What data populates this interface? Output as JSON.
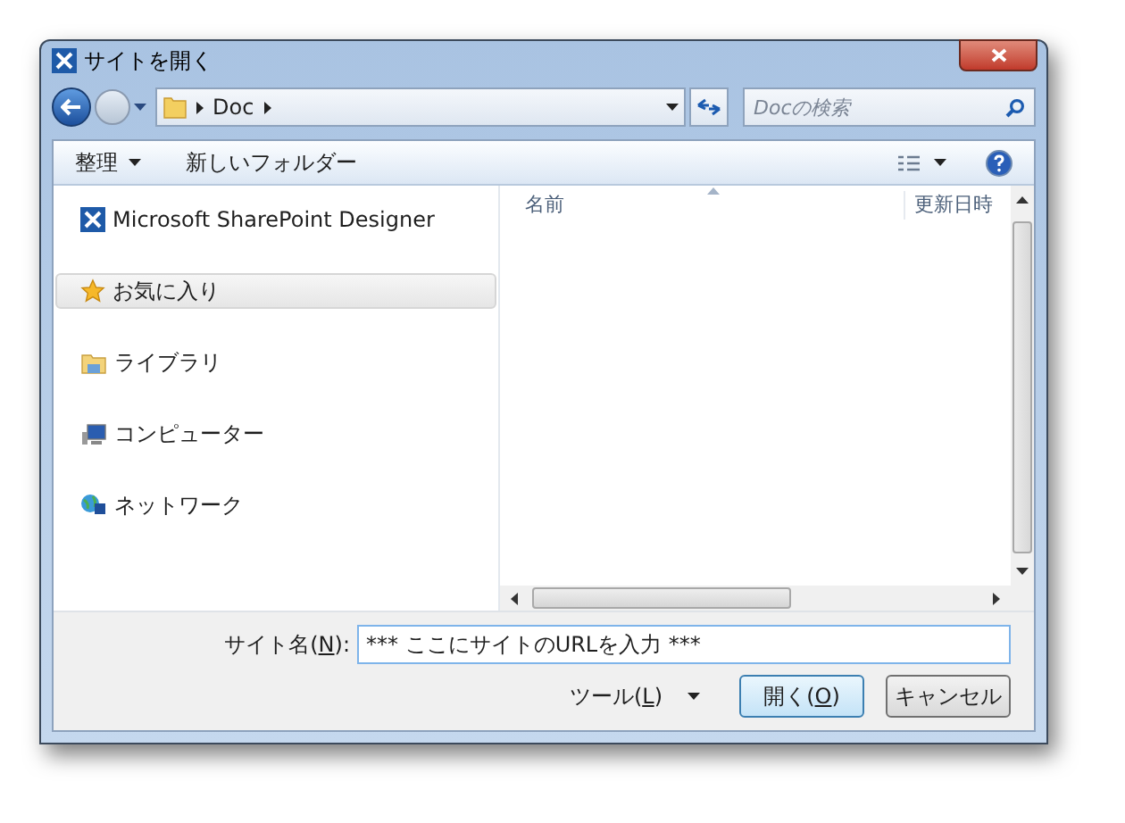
{
  "window": {
    "title": "サイトを開く"
  },
  "address_bar": {
    "crumbs": [
      "Doc"
    ]
  },
  "search": {
    "placeholder": "Docの検索"
  },
  "toolbar": {
    "organize": "整理",
    "new_folder": "新しいフォルダー"
  },
  "sidebar": {
    "items": [
      {
        "kind": "sharepoint",
        "label": "Microsoft SharePoint Designer",
        "selected": false
      },
      {
        "kind": "favorites",
        "label": "お気に入り",
        "selected": true
      },
      {
        "kind": "libraries",
        "label": "ライブラリ",
        "selected": false
      },
      {
        "kind": "computer",
        "label": "コンピューター",
        "selected": false
      },
      {
        "kind": "network",
        "label": "ネットワーク",
        "selected": false
      }
    ]
  },
  "file_list": {
    "columns": [
      "名前",
      "更新日時"
    ]
  },
  "site_name": {
    "label_parts": [
      "サイト名(",
      "N",
      "):"
    ],
    "value": "*** ここにサイトのURLを入力 ***"
  },
  "buttons": [
    {
      "kind": "menu",
      "parts": [
        "ツール(",
        "L",
        ")"
      ]
    },
    {
      "kind": "default",
      "parts": [
        "開く(",
        "O",
        ")"
      ]
    },
    {
      "kind": "plain",
      "parts": [
        "キャンセル"
      ]
    }
  ]
}
